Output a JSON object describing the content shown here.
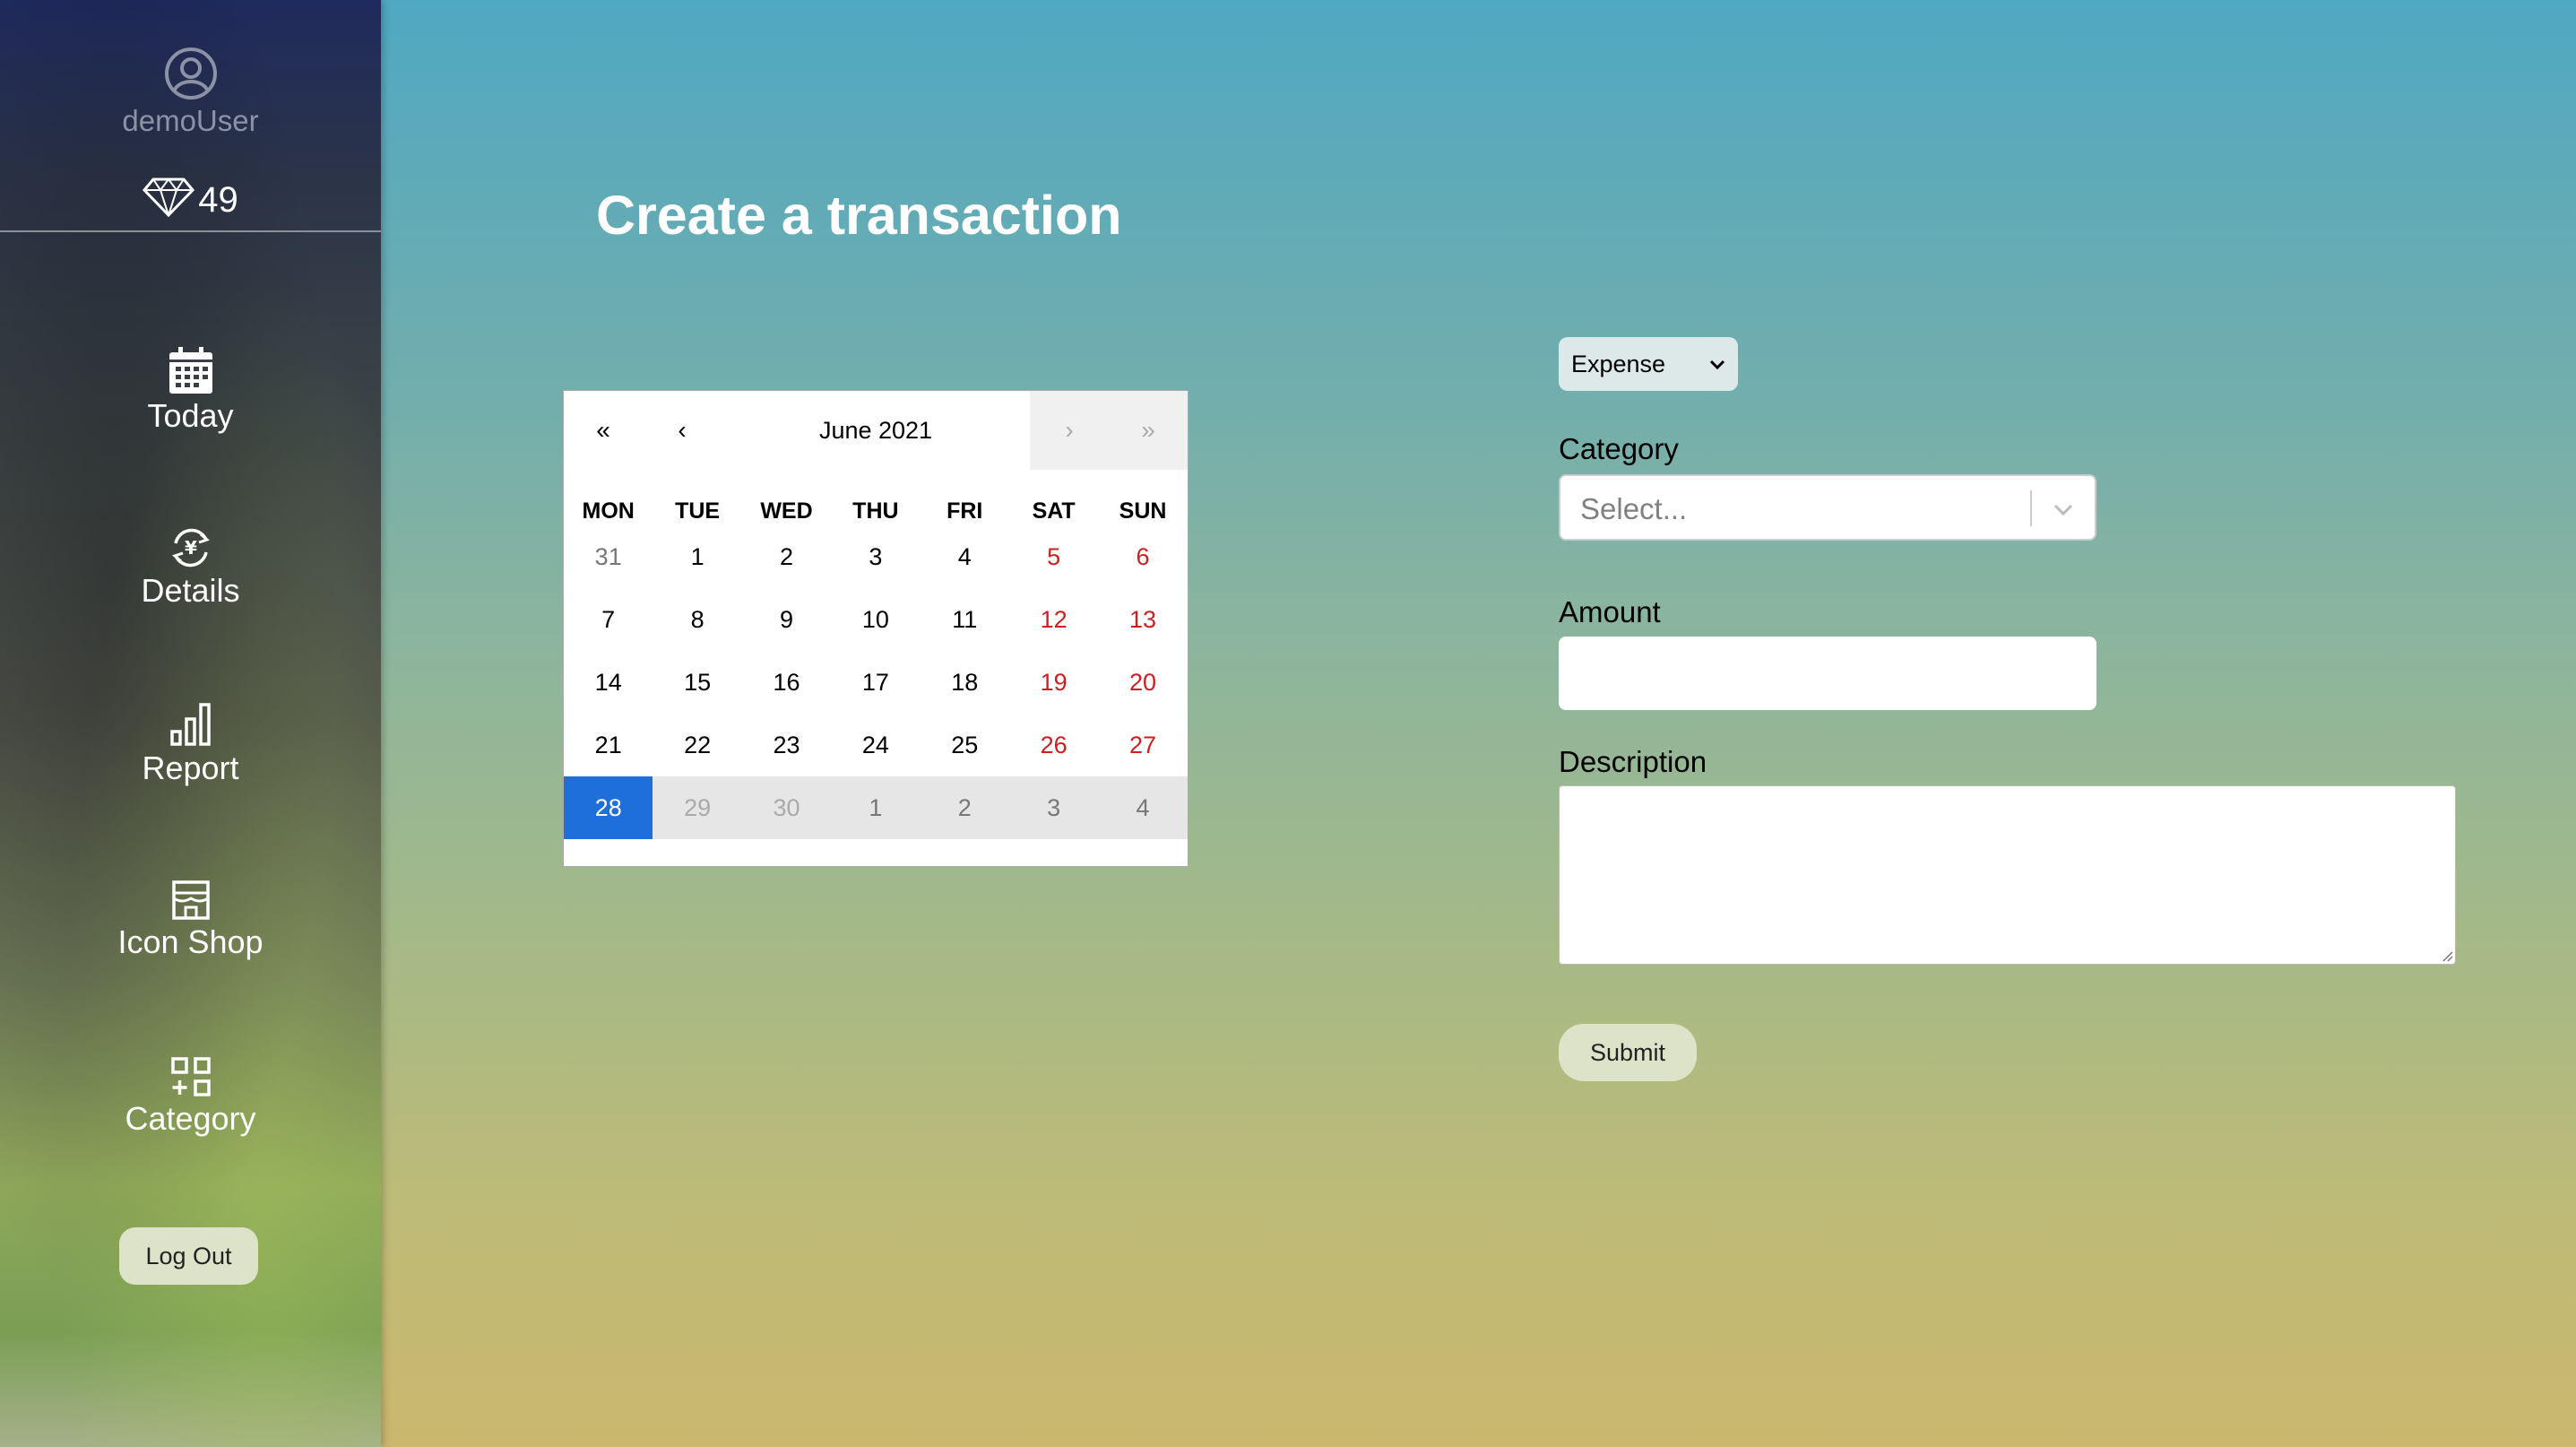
{
  "sidebar": {
    "username": "demoUser",
    "gems": "49",
    "nav": {
      "today": "Today",
      "details": "Details",
      "report": "Report",
      "icon_shop": "Icon Shop",
      "category": "Category"
    },
    "logout_label": "Log Out"
  },
  "main": {
    "title": "Create a transaction",
    "calendar": {
      "nav_first": "«",
      "nav_prev": "‹",
      "month_label": "June 2021",
      "nav_next": "›",
      "nav_last": "»",
      "weekdays": [
        "MON",
        "TUE",
        "WED",
        "THU",
        "FRI",
        "SAT",
        "SUN"
      ],
      "weeks": [
        [
          "31",
          "1",
          "2",
          "3",
          "4",
          "5",
          "6"
        ],
        [
          "7",
          "8",
          "9",
          "10",
          "11",
          "12",
          "13"
        ],
        [
          "14",
          "15",
          "16",
          "17",
          "18",
          "19",
          "20"
        ],
        [
          "21",
          "22",
          "23",
          "24",
          "25",
          "26",
          "27"
        ],
        [
          "28",
          "29",
          "30",
          "1",
          "2",
          "3",
          "4"
        ]
      ],
      "selected_day": "28",
      "weekend_color": "#cc1f1f",
      "selected_color": "#1e6fd9"
    },
    "form": {
      "type_value": "Expense",
      "category_label": "Category",
      "category_placeholder": "Select...",
      "amount_label": "Amount",
      "amount_value": "",
      "description_label": "Description",
      "description_value": "",
      "submit_label": "Submit"
    }
  },
  "icons": {
    "user": "user-circle-icon",
    "gem": "diamond-icon",
    "today": "calendar-icon",
    "details": "yen-exchange-icon",
    "report": "bar-chart-icon",
    "icon_shop": "shop-icon",
    "category": "category-grid-icon"
  }
}
